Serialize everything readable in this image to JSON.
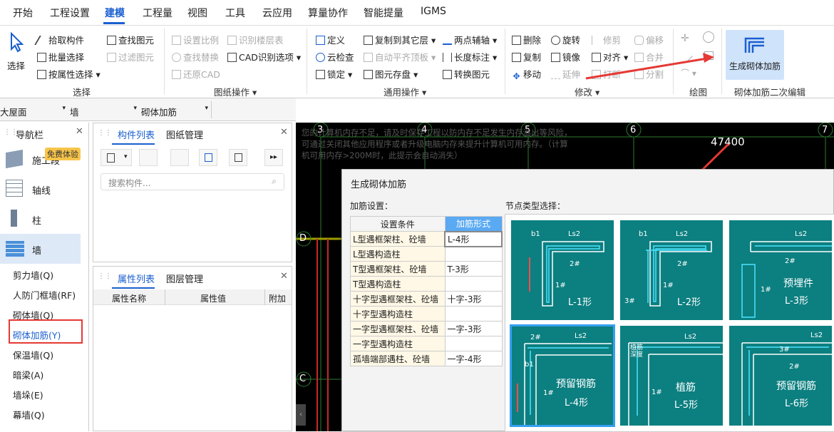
{
  "menu": [
    "开始",
    "工程设置",
    "建模",
    "工程量",
    "视图",
    "工具",
    "云应用",
    "算量协作",
    "智能提量",
    "IGMS"
  ],
  "ribbon": {
    "select_label": "选择",
    "col1": [
      "拾取构件",
      "批量选择",
      "按属性选择"
    ],
    "col2": [
      "查找图元",
      "过滤图元"
    ],
    "col3": [
      "设置比例",
      "查找替换",
      "还原CAD"
    ],
    "col4": [
      "识别楼层表",
      "CAD识别选项"
    ],
    "col5": [
      "定义",
      "云检查",
      "锁定"
    ],
    "col6": [
      "复制到其它层",
      "自动平齐顶板",
      "图元存盘"
    ],
    "col7": [
      "两点辅轴",
      "长度标注",
      "转换图元"
    ],
    "col8": [
      "删除",
      "复制",
      "移动"
    ],
    "col9": [
      "旋转",
      "镜像",
      "延伸"
    ],
    "col10": [
      "修剪",
      "对齐",
      "打断"
    ],
    "col11": [
      "偏移",
      "合并",
      "分割"
    ],
    "gen_btn": "生成砌体加筋",
    "groups": [
      "选择",
      "图纸操作",
      "通用操作",
      "修改",
      "绘图",
      "砌体加筋二次编辑"
    ]
  },
  "selectors": [
    "大屋面",
    "墙",
    "砌体加筋"
  ],
  "nav": {
    "title": "导航栏",
    "badge": "免费体验",
    "items": [
      "施工段",
      "轴线",
      "柱",
      "墙"
    ],
    "sub": [
      "剪力墙(Q)",
      "人防门框墙(RF)",
      "砌体墙(Q)",
      "砌体加筋(Y)",
      "保温墙(Q)",
      "暗梁(A)",
      "墙垛(E)",
      "幕墙(Q)"
    ]
  },
  "comp": {
    "tabs": [
      "构件列表",
      "图纸管理"
    ],
    "search_placeholder": "搜索构件..."
  },
  "prop": {
    "tabs": [
      "属性列表",
      "图层管理"
    ],
    "cols": [
      "属性名称",
      "属性值",
      "附加"
    ]
  },
  "cad": {
    "axes": [
      "3",
      "4",
      "5",
      "6",
      "7",
      "D",
      "C"
    ],
    "dimension": "47400",
    "warning": "您的计算机内存不足，请及时保存工程以防内存不足发生内存溢出等风险，可通过关闭其他应用程序或者升级电脑内存来提升计算机可用内存。（计算机可用内存>200M时，此提示会自动消失）"
  },
  "dialog": {
    "title": "生成砌体加筋",
    "left_label": "加筋设置：",
    "right_label": "节点类型选择：",
    "col_headers": [
      "设置条件",
      "加筋形式"
    ],
    "rows": [
      [
        "L型遇框架柱、砼墙",
        "L-4形"
      ],
      [
        "L型遇构造柱",
        ""
      ],
      [
        "T型遇框架柱、砼墙",
        "T-3形"
      ],
      [
        "T型遇构造柱",
        ""
      ],
      [
        "十字型遇框架柱、砼墙",
        "十字-3形"
      ],
      [
        "十字型遇构造柱",
        ""
      ],
      [
        "一字型遇框架柱、砼墙",
        "一字-3形"
      ],
      [
        "一字型遇构造柱",
        ""
      ],
      [
        "孤墙端部遇柱、砼墙",
        "一字-4形"
      ]
    ],
    "nodes": [
      {
        "name": "L-1形",
        "extra": ""
      },
      {
        "name": "L-2形",
        "extra": ""
      },
      {
        "name": "L-3形",
        "extra": "预埋件"
      },
      {
        "name": "L-4形",
        "extra": "预留钢筋"
      },
      {
        "name": "L-5形",
        "extra": "植筋"
      },
      {
        "name": "L-6形",
        "extra": "预留钢筋"
      }
    ],
    "node_marks": [
      "b1",
      "Ls2",
      "2#",
      "1#",
      "3#",
      "Ls1",
      "b2",
      "植筋深度"
    ]
  },
  "colors": {
    "accent": "#1a5fd0",
    "node_bg": "#0c7f80",
    "highlight_red": "#e53935"
  }
}
